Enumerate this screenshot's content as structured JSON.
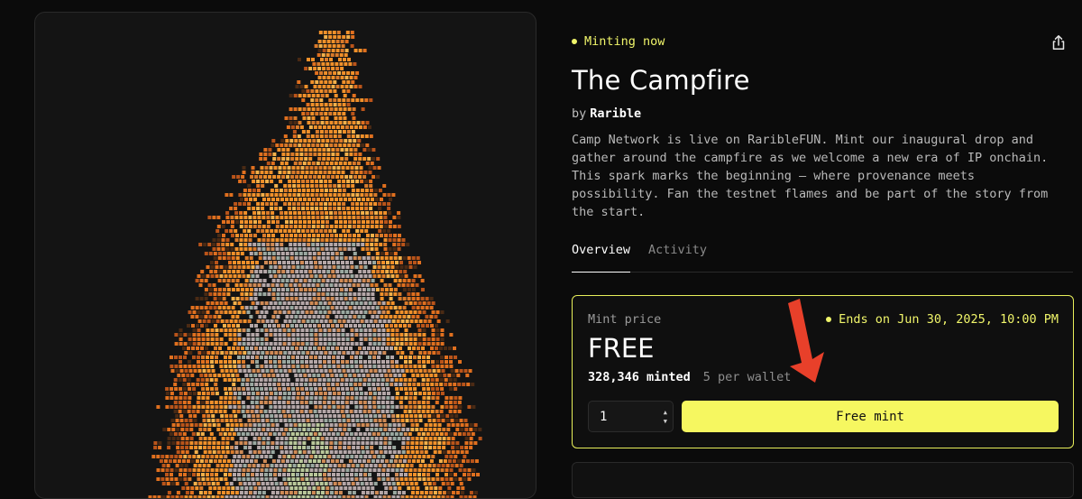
{
  "artwork": {
    "name": "The Campfire pixel flame artwork"
  },
  "status": {
    "label": "Minting now",
    "color": "#f0f56a"
  },
  "share": {
    "icon": "share-icon"
  },
  "collection": {
    "title": "The Campfire",
    "by_prefix": "by",
    "creator": "Rarible",
    "description": "Camp Network is live on RaribleFUN. Mint our inaugural drop and gather around the campfire as we welcome a new era of IP onchain. This spark marks the beginning — where provenance meets possibility. Fan the testnet flames and be part of the story from the start."
  },
  "tabs": [
    {
      "label": "Overview",
      "active": true
    },
    {
      "label": "Activity",
      "active": false
    }
  ],
  "mint": {
    "label": "Mint price",
    "price": "FREE",
    "ends": "Ends on Jun 30, 2025, 10:00 PM",
    "minted": "328,346 minted",
    "per_wallet": "5 per wallet",
    "quantity": "1",
    "button_label": "Free mint",
    "accent": "#f6f760",
    "border": "#e8ef5a"
  },
  "annotation": {
    "icon": "red-arrow-icon",
    "color": "#e8402a"
  }
}
